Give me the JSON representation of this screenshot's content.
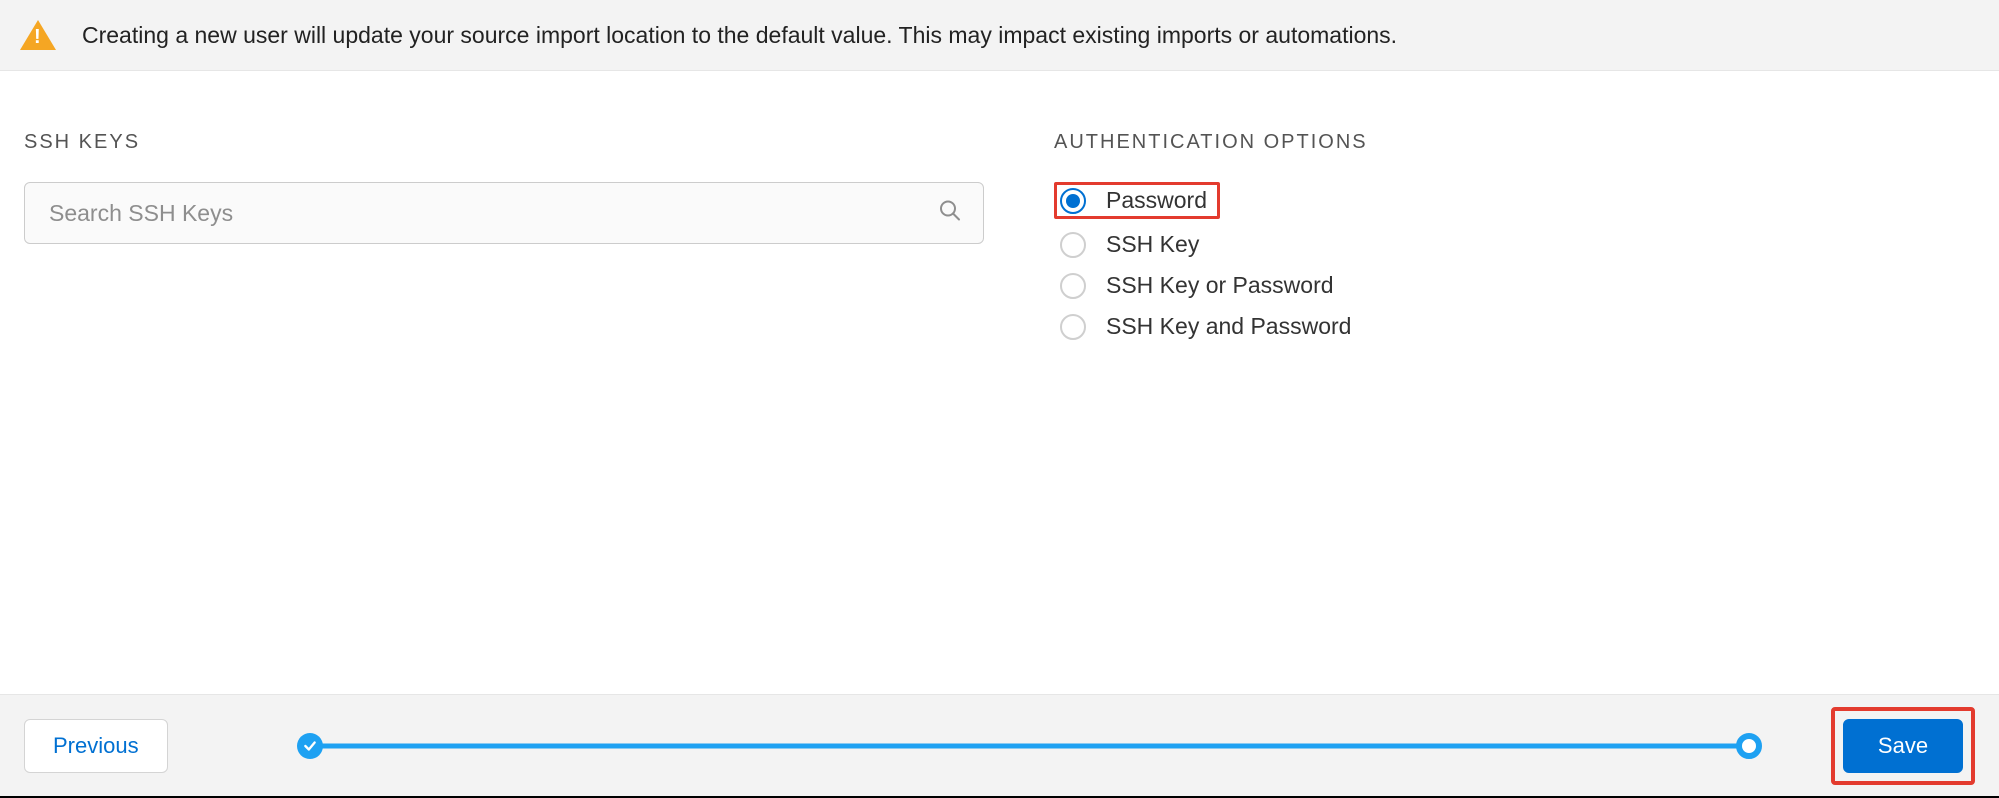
{
  "banner": {
    "message": "Creating a new user will update your source import location to the default value. This may impact existing imports or automations."
  },
  "ssh": {
    "heading": "SSH KEYS",
    "search_placeholder": "Search SSH Keys"
  },
  "auth": {
    "heading": "AUTHENTICATION OPTIONS",
    "options": [
      {
        "label": "Password",
        "selected": true
      },
      {
        "label": "SSH Key",
        "selected": false
      },
      {
        "label": "SSH Key or Password",
        "selected": false
      },
      {
        "label": "SSH Key and Password",
        "selected": false
      }
    ]
  },
  "footer": {
    "previous": "Previous",
    "save": "Save"
  }
}
